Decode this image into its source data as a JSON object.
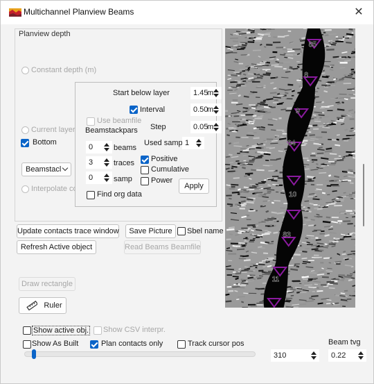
{
  "window": {
    "title": "Multichannel Planview Beams",
    "close_glyph": "✕"
  },
  "depth_group": {
    "title": "Planview depth",
    "constant_depth": "Constant depth (m)",
    "current_layer": "Current layer",
    "bottom": "Bottom",
    "beamstack_combo": "Beamstacl",
    "interpolate": "Interpolate co"
  },
  "beam_params": {
    "start_below_layer": {
      "label": "Start below layer",
      "value": "1.45",
      "unit": "m"
    },
    "interval": {
      "label": "Interval",
      "value": "0.50",
      "unit": "m",
      "checked": true
    },
    "use_beamfile": {
      "label": "Use beamfile"
    },
    "step": {
      "label": "Step",
      "value": "0.05",
      "unit": "m"
    },
    "beamstackpars_label": "Beamstackpars",
    "used_samp": {
      "label": "Used samp",
      "value": "1"
    },
    "beams": {
      "value": "0",
      "label": "beams"
    },
    "traces": {
      "value": "3",
      "label": "traces"
    },
    "samp": {
      "value": "0",
      "label": "samp"
    },
    "positive": {
      "label": "Positive",
      "checked": true
    },
    "cumulative": {
      "label": "Cumulative",
      "checked": false
    },
    "power": {
      "label": "Power",
      "checked": false
    },
    "apply": "Apply",
    "find_org_data": "Find org data"
  },
  "actions": {
    "update_contacts": "Update contacts trace window",
    "save_picture": "Save Picture",
    "sbel_name": "Sbel name",
    "refresh_active": "Refresh Active object",
    "read_beams": "Read Beams Beamfile",
    "draw_rectangle": "Draw rectangle",
    "ruler": "Ruler"
  },
  "image_labels": [
    "85",
    "8",
    "9",
    "84",
    "10",
    "83",
    "11"
  ],
  "bottom_bar": {
    "show_active_obj": "Show active obj.",
    "show_csv": "Show CSV interpr.",
    "show_as_built": "Show As Built",
    "plan_contacts_only": "Plan contacts only",
    "track_cursor": "Track cursor pos",
    "beam_tvg_label": "Beam tvg",
    "position_value": "310",
    "beam_tvg_value": "0.22",
    "slider_fraction": 0.02
  },
  "colors": {
    "accent": "#0a64c8",
    "marker": "#8a1a9e"
  }
}
